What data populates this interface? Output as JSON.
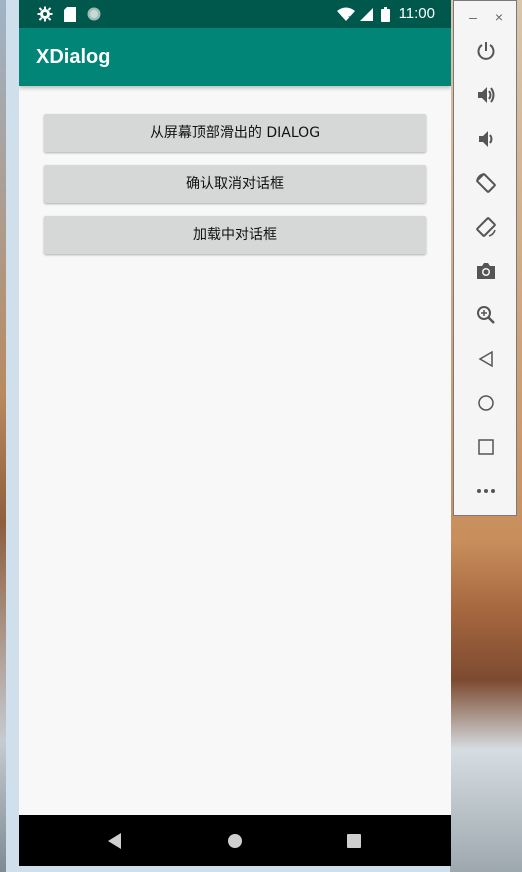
{
  "status_bar": {
    "time": "11:00",
    "icons": [
      "settings-icon",
      "sd-card-icon",
      "circle-icon",
      "wifi-icon",
      "signal-icon",
      "battery-icon"
    ]
  },
  "app_bar": {
    "title": "XDialog"
  },
  "buttons": [
    {
      "label": "从屏幕顶部滑出的 DIALOG"
    },
    {
      "label": "确认取消对话框"
    },
    {
      "label": "加载中对话框"
    }
  ],
  "nav_bar": {
    "icons": [
      "back-icon",
      "home-icon",
      "recents-icon"
    ]
  },
  "emulator_toolbar": {
    "minimize": "–",
    "close": "×",
    "tools": [
      "power-icon",
      "volume-up-icon",
      "volume-down-icon",
      "rotate-left-icon",
      "rotate-right-icon",
      "camera-icon",
      "zoom-icon",
      "back-icon",
      "home-icon",
      "overview-icon",
      "more-icon"
    ]
  },
  "colors": {
    "status_bar": "#00574b",
    "app_bar": "#008577",
    "screen_bg": "#f8f8f8",
    "button_bg": "#d6d7d7",
    "nav_bar": "#000000"
  }
}
